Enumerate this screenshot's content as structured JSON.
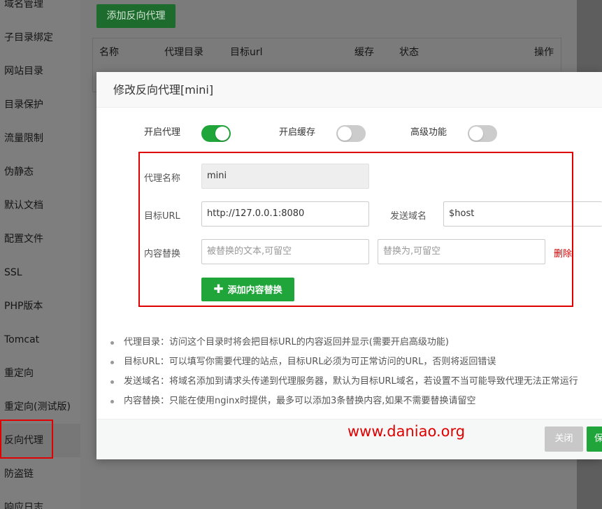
{
  "sidebar": {
    "items": [
      {
        "label": "域名管理"
      },
      {
        "label": "子目录绑定"
      },
      {
        "label": "网站目录"
      },
      {
        "label": "目录保护"
      },
      {
        "label": "流量限制"
      },
      {
        "label": "伪静态"
      },
      {
        "label": "默认文档"
      },
      {
        "label": "配置文件"
      },
      {
        "label": "SSL"
      },
      {
        "label": "PHP版本"
      },
      {
        "label": "Tomcat"
      },
      {
        "label": "重定向"
      },
      {
        "label": "重定向(测试版)"
      },
      {
        "label": "反向代理"
      },
      {
        "label": "防盗链"
      },
      {
        "label": "响应日志"
      }
    ]
  },
  "background": {
    "add_button": "添加反向代理",
    "table_headers": [
      "名称",
      "代理目录",
      "目标url",
      "缓存",
      "状态",
      "操作"
    ]
  },
  "modal": {
    "title": "修改反向代理[mini]",
    "toggles": {
      "proxy": {
        "label": "开启代理",
        "state": "on"
      },
      "cache": {
        "label": "开启缓存",
        "state": "off"
      },
      "advanced": {
        "label": "高级功能",
        "state": "off"
      }
    },
    "form": {
      "name_label": "代理名称",
      "name_value": "mini",
      "target_label": "目标URL",
      "target_value": "http://127.0.0.1:8080",
      "send_domain_label": "发送域名",
      "send_domain_value": "$host",
      "replace_label": "内容替换",
      "replace_from_placeholder": "被替换的文本,可留空",
      "replace_to_placeholder": "替换为,可留空",
      "delete_label": "删除",
      "add_replace_button": "添加内容替换"
    },
    "tips": [
      "代理目录：访问这个目录时将会把目标URL的内容返回并显示(需要开启高级功能)",
      "目标URL：可以填写你需要代理的站点，目标URL必须为可正常访问的URL，否则将返回错误",
      "发送域名：将域名添加到请求头传递到代理服务器，默认为目标URL域名，若设置不当可能导致代理无法正常运行",
      "内容替换：只能在使用nginx时提供，最多可以添加3条替换内容,如果不需要替换请留空"
    ],
    "watermark": "www.daniao.org",
    "buttons": {
      "close": "关闭",
      "save": "保存"
    }
  },
  "colors": {
    "accent": "#20a53a",
    "annotation": "#e00000"
  }
}
